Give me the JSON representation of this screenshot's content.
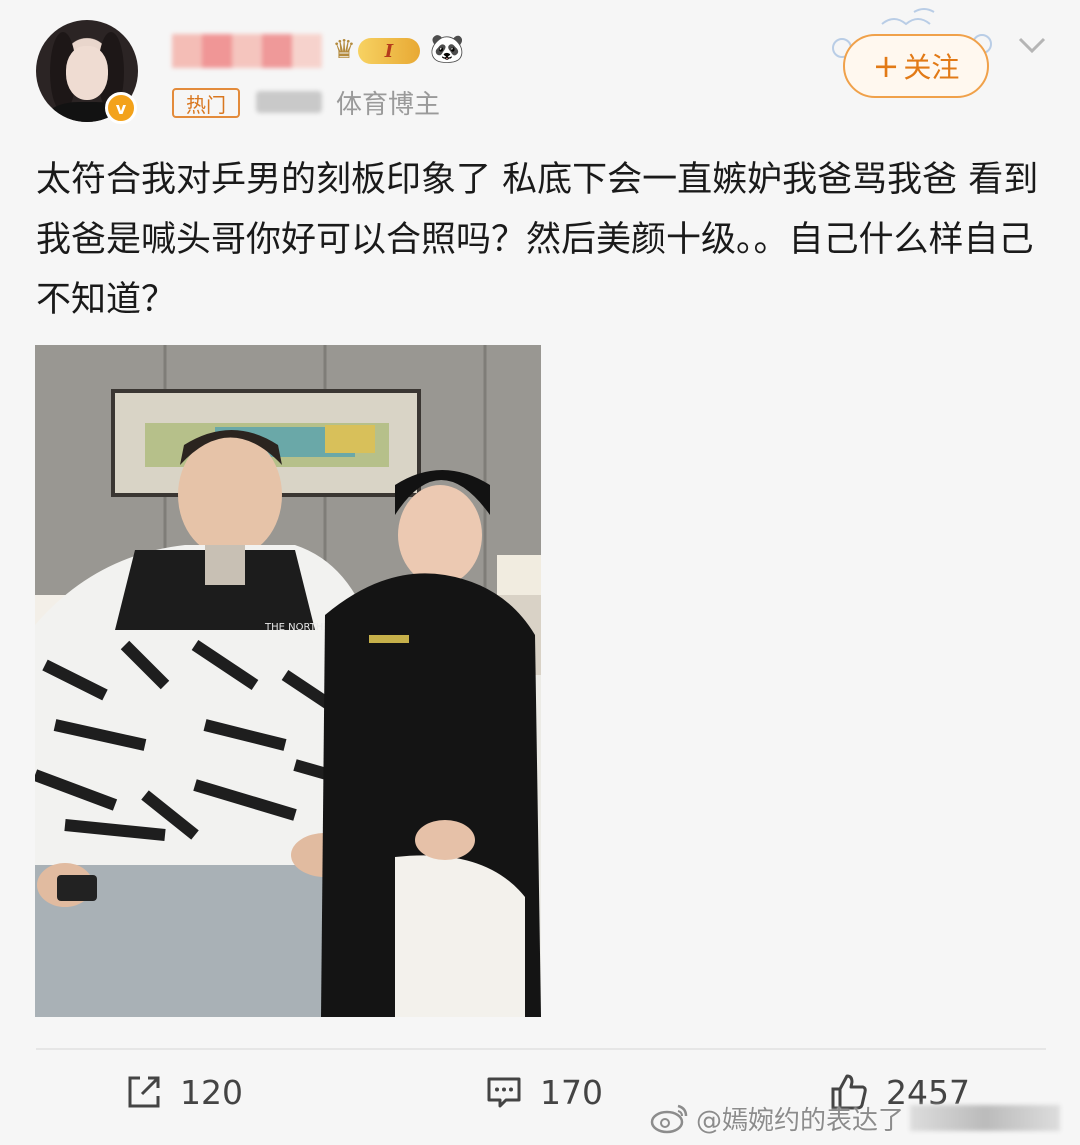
{
  "author": {
    "badge_v": "v",
    "level": "I",
    "hot_tag": "热门",
    "category": "体育博主"
  },
  "follow_button": {
    "plus": "+",
    "label": "关注"
  },
  "post": {
    "text": "太符合我对乒男的刻板印象了 私底下会一直嫉妒我爸骂我爸 看到我爸是喊头哥你好可以合照吗？然后美颜十级。。自己什么样自己不知道？"
  },
  "photo": {
    "jacket_brand": "THE NORTH FACE"
  },
  "actions": {
    "repost_count": "120",
    "comment_count": "170",
    "like_count": "2457"
  },
  "watermark": {
    "text": "@嫣婉约的表达了"
  },
  "colors": {
    "accent_orange": "#e27a16",
    "hot_tag": "#d9771f",
    "background": "#f6f6f6"
  },
  "icons": {
    "repost": "share-square-icon",
    "comment": "comment-bubble-icon",
    "like": "thumbs-up-icon",
    "chevron": "chevron-down-icon"
  }
}
